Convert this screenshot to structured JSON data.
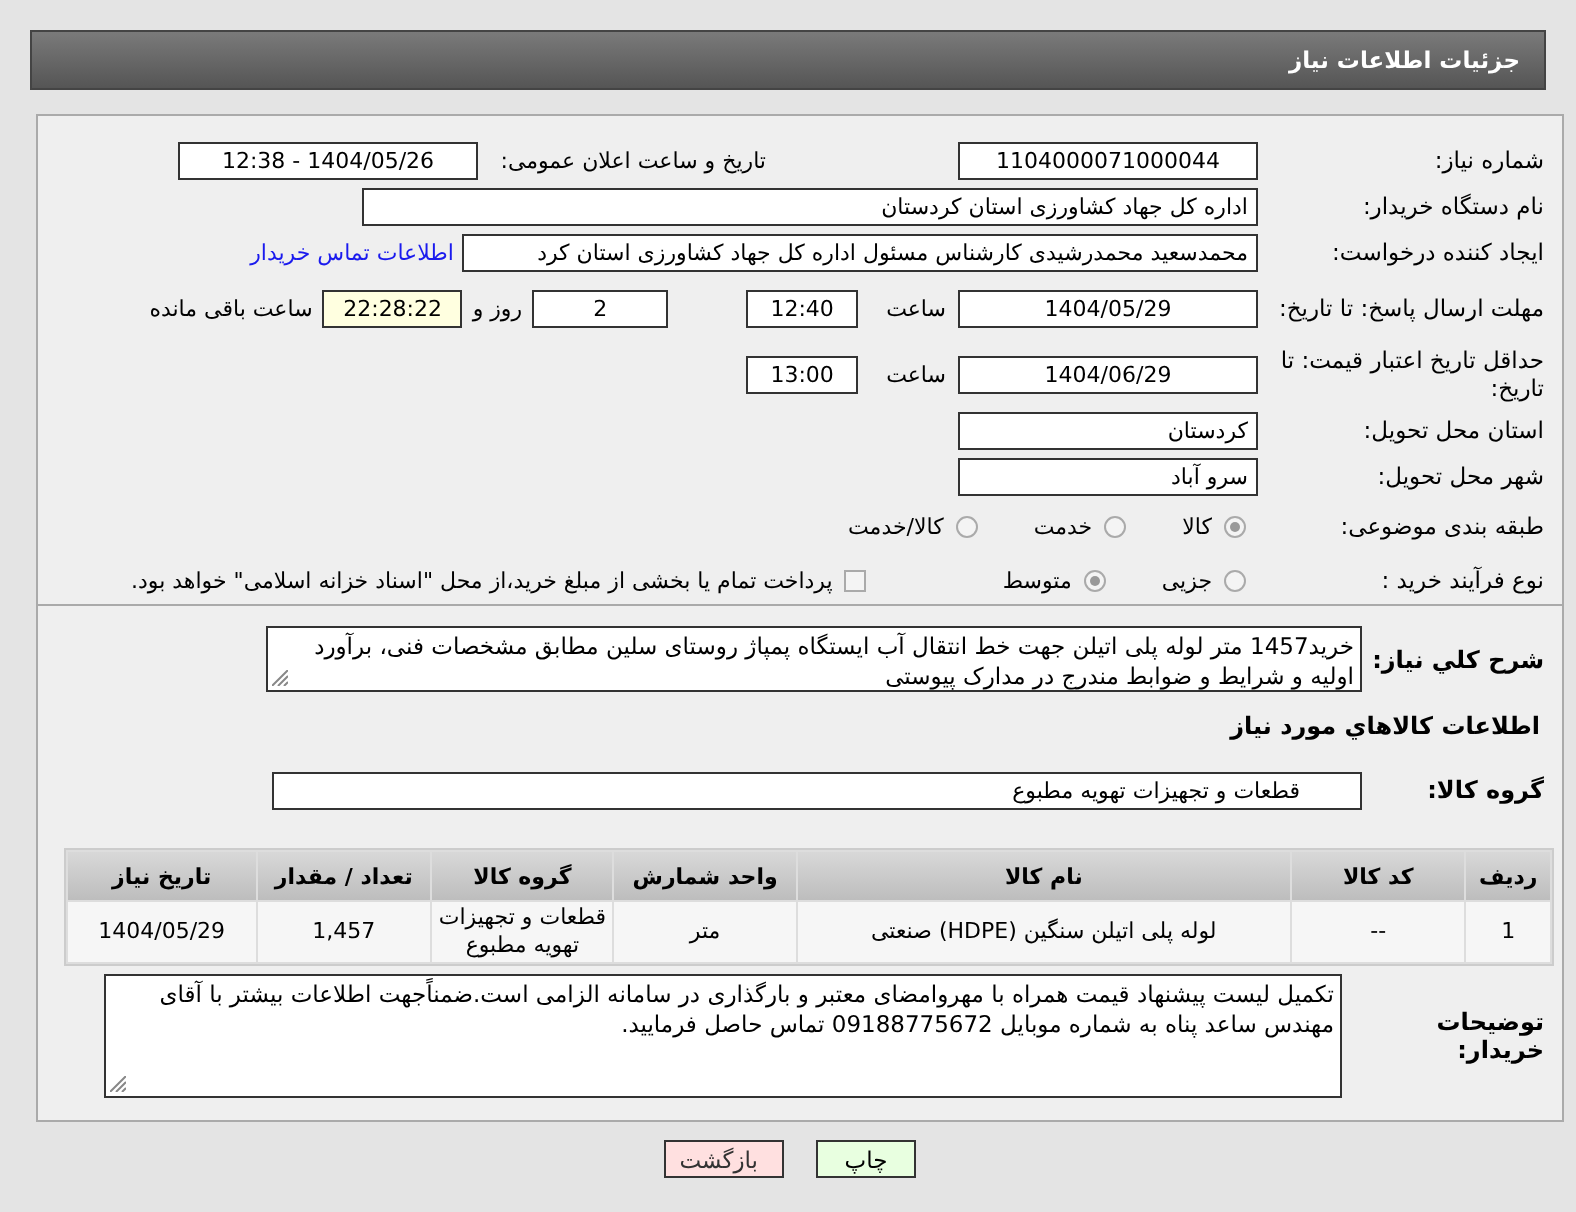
{
  "header": {
    "title": "جزئیات اطلاعات نیاز"
  },
  "need_number": {
    "label": "شماره نیاز:",
    "value": "1104000071000044"
  },
  "announce": {
    "label": "تاریخ و ساعت اعلان عمومی:",
    "value": "1404/05/26 - 12:38"
  },
  "buyer_org": {
    "label": "نام دستگاه خریدار:",
    "value": "اداره کل جهاد کشاورزی استان کردستان"
  },
  "requester": {
    "label": "ایجاد کننده درخواست:",
    "value": "محمدسعید محمدرشیدی کارشناس مسئول اداره کل جهاد کشاورزی استان کرد",
    "link": "اطلاعات تماس خریدار"
  },
  "reply_deadline": {
    "label": "مهلت ارسال پاسخ: تا تاریخ:",
    "date": "1404/05/29",
    "time_label": "ساعت",
    "time": "12:40",
    "days": "2",
    "days_label": "روز و",
    "remaining": "22:28:22",
    "remaining_label": "ساعت باقی مانده"
  },
  "price_validity": {
    "label": "حداقل تاریخ اعتبار قیمت: تا تاریخ:",
    "date": "1404/06/29",
    "time_label": "ساعت",
    "time": "13:00"
  },
  "province": {
    "label": "استان محل تحویل:",
    "value": "کردستان"
  },
  "city": {
    "label": "شهر محل تحویل:",
    "value": "سرو آباد"
  },
  "category": {
    "label": "طبقه بندی موضوعی:",
    "options": [
      {
        "label": "کالا",
        "selected": true
      },
      {
        "label": "خدمت",
        "selected": false
      },
      {
        "label": "کالا/خدمت",
        "selected": false
      }
    ]
  },
  "process": {
    "label": "نوع فرآیند خرید :",
    "options": [
      {
        "label": "جزیی",
        "selected": false
      },
      {
        "label": "متوسط",
        "selected": true
      }
    ],
    "payment": {
      "label": "پرداخت تمام یا بخشی از مبلغ خرید،از محل \"اسناد خزانه اسلامی\" خواهد بود.",
      "checked": false
    }
  },
  "description": {
    "label": "شرح کلي نياز:",
    "value": "خرید1457 متر لوله پلی اتیلن جهت خط انتقال آب ایستگاه پمپاژ روستای سلین مطابق مشخصات فنی، برآورد اولیه و شرایط و ضوابط مندرج در مدارک پیوستی"
  },
  "goods_title": "اطلاعات کالاهاي مورد نياز",
  "goods_group": {
    "label": "گروه کالا:",
    "value": "قطعات و تجهیزات تهویه مطبوع"
  },
  "table": {
    "columns": [
      "ردیف",
      "کد کالا",
      "نام کالا",
      "واحد شمارش",
      "گروه کالا",
      "تعداد / مقدار",
      "تاریخ نیاز"
    ],
    "rows": [
      [
        "1",
        "--",
        "لوله پلی اتیلن سنگین (HDPE) صنعتی",
        "متر",
        "قطعات و تجهیزات تهویه مطبوع",
        "1,457",
        "1404/05/29"
      ]
    ]
  },
  "buyer_notes": {
    "label": "توضیحات خریدار:",
    "value": "تکمیل لیست پیشنهاد قیمت همراه با مهروامضای معتبر و بارگذاری در سامانه الزامی است.ضمناًجهت اطلاعات بیشتر با آقای مهندس ساعد پناه به شماره موبایل 09188775672 تماس حاصل فرمایید."
  },
  "buttons": [
    {
      "label": "چاپ",
      "kind": "print"
    },
    {
      "label": "بازگشت",
      "kind": "back"
    }
  ]
}
